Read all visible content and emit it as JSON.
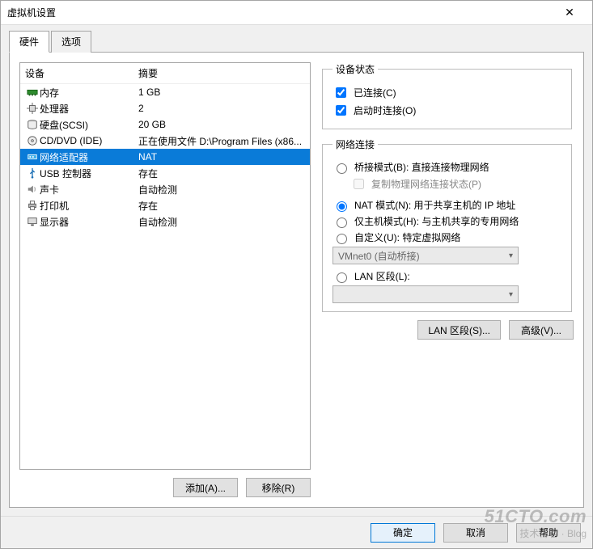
{
  "window": {
    "title": "虚拟机设置"
  },
  "tabs": {
    "hardware": "硬件",
    "options": "选项"
  },
  "devlist": {
    "col_device": "设备",
    "col_summary": "摘要",
    "rows": [
      {
        "name": "内存",
        "summary": "1 GB"
      },
      {
        "name": "处理器",
        "summary": "2"
      },
      {
        "name": "硬盘(SCSI)",
        "summary": "20 GB"
      },
      {
        "name": "CD/DVD (IDE)",
        "summary": "正在使用文件 D:\\Program Files (x86..."
      },
      {
        "name": "网络适配器",
        "summary": "NAT"
      },
      {
        "name": "USB 控制器",
        "summary": "存在"
      },
      {
        "name": "声卡",
        "summary": "自动检测"
      },
      {
        "name": "打印机",
        "summary": "存在"
      },
      {
        "name": "显示器",
        "summary": "自动检测"
      }
    ]
  },
  "leftbtn": {
    "add": "添加(A)...",
    "remove": "移除(R)"
  },
  "state": {
    "legend": "设备状态",
    "connected": "已连接(C)",
    "connect_at_poweron": "启动时连接(O)"
  },
  "net": {
    "legend": "网络连接",
    "bridged": "桥接模式(B): 直接连接物理网络",
    "replicate": "复制物理网络连接状态(P)",
    "nat": "NAT 模式(N): 用于共享主机的 IP 地址",
    "hostonly": "仅主机模式(H): 与主机共享的专用网络",
    "custom": "自定义(U): 特定虚拟网络",
    "vmnet_value": "VMnet0 (自动桥接)",
    "lan": "LAN 区段(L):"
  },
  "rightbtn": {
    "lan": "LAN 区段(S)...",
    "adv": "高级(V)..."
  },
  "footer": {
    "ok": "确定",
    "cancel": "取消",
    "help": "帮助"
  },
  "watermark": {
    "big": "51CTO.com",
    "small": "技术博客 · Blog"
  }
}
